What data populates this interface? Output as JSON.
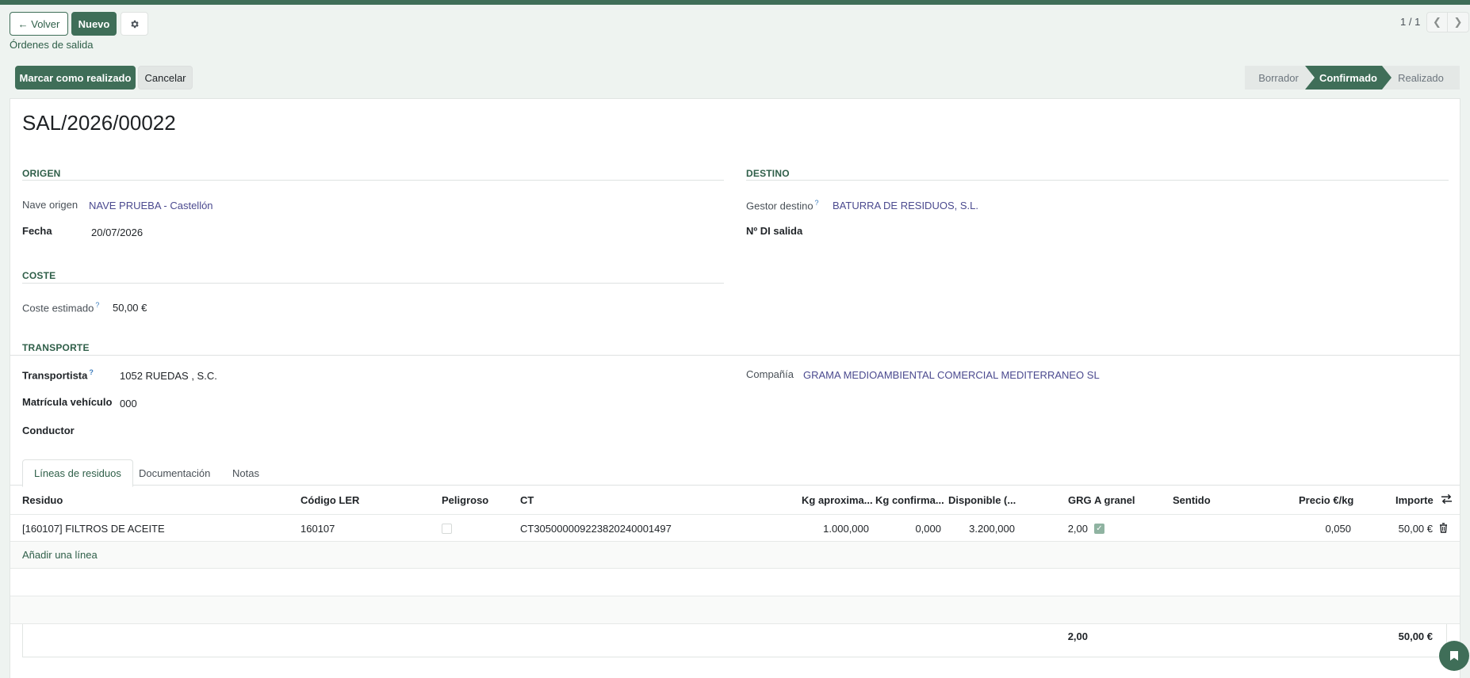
{
  "controls": {
    "back_label": "← Volver",
    "new_label": "Nuevo",
    "breadcrumb": "Órdenes de salida",
    "pager": "1 / 1"
  },
  "actions": {
    "done_label": "Marcar como realizado",
    "cancel_label": "Cancelar"
  },
  "statusbar": {
    "draft": "Borrador",
    "confirmed": "Confirmado",
    "done": "Realizado",
    "active": "Confirmado"
  },
  "record": {
    "name": "SAL/2026/00022"
  },
  "origen": {
    "section": "ORIGEN",
    "nave_label": "Nave origen",
    "nave_value": "NAVE PRUEBA - Castellón",
    "fecha_label": "Fecha",
    "fecha_value": "20/07/2026"
  },
  "destino": {
    "section": "DESTINO",
    "gestor_label": "Gestor destino",
    "gestor_value": "BATURRA DE RESIDUOS, S.L.",
    "di_label": "Nº DI salida"
  },
  "coste": {
    "section": "COSTE",
    "estimado_label": "Coste estimado",
    "estimado_value": "50,00 €"
  },
  "transporte": {
    "section": "TRANSPORTE",
    "transportista_label": "Transportista",
    "transportista_value": "1052 RUEDAS , S.C.",
    "matricula_label": "Matrícula vehículo",
    "matricula_value": "000",
    "conductor_label": "Conductor",
    "compania_label": "Compañía",
    "compania_value": "GRAMA MEDIOAMBIENTAL COMERCIAL MEDITERRANEO SL"
  },
  "help_mark": "?",
  "tabs": [
    "Líneas de residuos",
    "Documentación",
    "Notas"
  ],
  "table": {
    "headers": [
      "Residuo",
      "Código LER",
      "Peligroso",
      "CT",
      "Kg aproxima...",
      "Kg confirma...",
      "Disponible (...",
      "GRG",
      "A granel",
      "Sentido",
      "Precio €/kg",
      "Importe"
    ],
    "rows": [
      {
        "residuo": "[160107] FILTROS DE ACEITE",
        "ler": "160107",
        "peligroso": false,
        "ct": "CT305000009223820240001497",
        "kg_aprox": "1.000,000",
        "kg_conf": "0,000",
        "disponible": "3.200,000",
        "grg": "2,00",
        "a_granel": true,
        "sentido": "",
        "precio": "0,050",
        "importe": "50,00 €"
      }
    ],
    "add_line": "Añadir una línea",
    "totals": {
      "grg": "2,00",
      "importe": "50,00 €"
    }
  },
  "icons": {
    "settings": "gear-icon",
    "prev": "chevron-left-icon",
    "next": "chevron-right-icon",
    "columns": "column-toggle-icon",
    "delete": "trash-icon",
    "chat": "chat-icon"
  },
  "colors": {
    "brand": "#3f6e58",
    "link": "#4b4a8f",
    "background": "#eef3f0"
  }
}
